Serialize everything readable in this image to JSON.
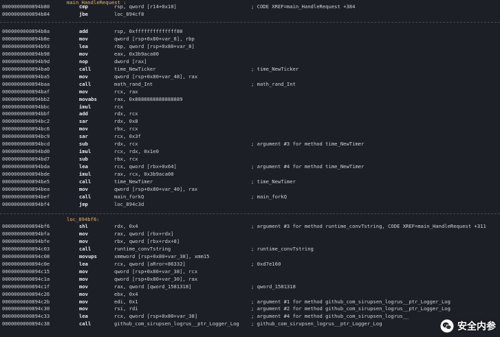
{
  "labels": {
    "top": "main_HandleRequest :",
    "mid": "loc_894bf6:"
  },
  "block1": [
    {
      "addr": "0000000000894b80",
      "mn": "cmp",
      "op": "rsp, qword [r14+0x10]",
      "comment": "; CODE XREF=main_HandleRequest +384"
    },
    {
      "addr": "0000000000894b84",
      "mn": "jbe",
      "op": "loc_894cf8",
      "comment": ""
    }
  ],
  "block2": [
    {
      "addr": "0000000000894b8a",
      "mn": "add",
      "op": "rsp, 0xffffffffffffff80",
      "comment": ""
    },
    {
      "addr": "0000000000894b8e",
      "mn": "mov",
      "op": "qword [rsp+0x80+var_8], rbp",
      "comment": ""
    },
    {
      "addr": "0000000000894b93",
      "mn": "lea",
      "op": "rbp, qword [rsp+0x80+var_8]",
      "comment": ""
    },
    {
      "addr": "0000000000894b98",
      "mn": "mov",
      "op": "eax, 0x3b9aca00",
      "comment": ""
    },
    {
      "addr": "0000000000894b9d",
      "mn": "nop",
      "op": "dword [rax]",
      "comment": ""
    },
    {
      "addr": "0000000000894ba0",
      "mn": "call",
      "op": "time_NewTicker",
      "comment": "; time_NewTicker"
    },
    {
      "addr": "0000000000894ba5",
      "mn": "mov",
      "op": "qword [rsp+0x80+var_48], rax",
      "comment": ""
    },
    {
      "addr": "0000000000894baa",
      "mn": "call",
      "op": "math_rand_Int",
      "comment": "; math_rand_Int"
    },
    {
      "addr": "0000000000894baf",
      "mn": "mov",
      "op": "rcx, rax",
      "comment": ""
    },
    {
      "addr": "0000000000894bb2",
      "mn": "movabs",
      "op": "rax, 0x8888888888888889",
      "comment": ""
    },
    {
      "addr": "0000000000894bbc",
      "mn": "imul",
      "op": "rcx",
      "comment": ""
    },
    {
      "addr": "0000000000894bbf",
      "mn": "add",
      "op": "rdx, rcx",
      "comment": ""
    },
    {
      "addr": "0000000000894bc2",
      "mn": "sar",
      "op": "rdx, 0x8",
      "comment": ""
    },
    {
      "addr": "0000000000894bc6",
      "mn": "mov",
      "op": "rbx, rcx",
      "comment": ""
    },
    {
      "addr": "0000000000894bc9",
      "mn": "sar",
      "op": "rcx, 0x3f",
      "comment": ""
    },
    {
      "addr": "0000000000894bcd",
      "mn": "sub",
      "op": "rdx, rcx",
      "comment": "; argument #3 for method time_NewTimer"
    },
    {
      "addr": "0000000000894bd0",
      "mn": "imul",
      "op": "rcx, rdx, 0x1e0",
      "comment": ""
    },
    {
      "addr": "0000000000894bd7",
      "mn": "sub",
      "op": "rbx, rcx",
      "comment": ""
    },
    {
      "addr": "0000000000894bda",
      "mn": "lea",
      "op": "rcx, qword [rbx+0x64]",
      "comment": "; argument #4 for method time_NewTimer"
    },
    {
      "addr": "0000000000894bde",
      "mn": "imul",
      "op": "rax, rcx, 0x3b9aca00",
      "comment": ""
    },
    {
      "addr": "0000000000894be5",
      "mn": "call",
      "op": "time_NewTimer",
      "comment": "; time_NewTimer"
    },
    {
      "addr": "0000000000894bea",
      "mn": "mov",
      "op": "qword [rsp+0x80+var_40], rax",
      "comment": ""
    },
    {
      "addr": "0000000000894bef",
      "mn": "call",
      "op": "main_forkQ",
      "comment": "; main_forkQ"
    },
    {
      "addr": "0000000000894bf4",
      "mn": "jmp",
      "op": "loc_894c3d",
      "comment": ""
    }
  ],
  "block3": [
    {
      "addr": "0000000000894bf6",
      "mn": "shl",
      "op": "rdx, 0x4",
      "comment": "; argument #3 for method runtime_convTstring, CODE XREF=main_HandleRequest +311"
    },
    {
      "addr": "0000000000894bfa",
      "mn": "mov",
      "op": "rax, qword [rbx+rdx]",
      "comment": ""
    },
    {
      "addr": "0000000000894bfe",
      "mn": "mov",
      "op": "rbx, qword [rbx+rdx+8]",
      "comment": ""
    },
    {
      "addr": "0000000000894c03",
      "mn": "call",
      "op": "runtime_convTstring",
      "comment": "; runtime_convTstring"
    },
    {
      "addr": "0000000000894c08",
      "mn": "movups",
      "op": "xmmword [rsp+0x80+var_38], xmm15",
      "comment": ""
    },
    {
      "addr": "0000000000894c0e",
      "mn": "lea",
      "op": "rcx, qword [aRror+86332]",
      "comment": "; 0xd7e160"
    },
    {
      "addr": "0000000000894c15",
      "mn": "mov",
      "op": "qword [rsp+0x80+var_38], rcx",
      "comment": ""
    },
    {
      "addr": "0000000000894c1a",
      "mn": "mov",
      "op": "qword [rsp+0x80+var_30], rax",
      "comment": ""
    },
    {
      "addr": "0000000000894c1f",
      "mn": "mov",
      "op": "rax, qword [qword_1581318]",
      "comment": "; qword_1581318"
    },
    {
      "addr": "0000000000894c26",
      "mn": "mov",
      "op": "ebx, 0x4",
      "comment": ""
    },
    {
      "addr": "0000000000894c2b",
      "mn": "mov",
      "op": "edi, 0x1",
      "comment": "; argument #1 for method github_com_sirupsen_logrus__ptr_Logger_Log"
    },
    {
      "addr": "0000000000894c30",
      "mn": "mov",
      "op": "rsi, rdi",
      "comment": "; argument #2 for method github_com_sirupsen_logrus__ptr_Logger_Log"
    },
    {
      "addr": "0000000000894c33",
      "mn": "lea",
      "op": "rcx, qword [rsp+0x80+var_38]",
      "comment": "; argument #4 for method github_com_sirupsen_logrus__"
    },
    {
      "addr": "0000000000894c38",
      "mn": "call",
      "op": "github_com_sirupsen_logrus__ptr_Logger_Log",
      "comment": "; github_com_sirupsen_logrus__ptr_Logger_Log"
    }
  ],
  "watermark": {
    "text": "安全内参",
    "icon": "wechat-icon"
  }
}
